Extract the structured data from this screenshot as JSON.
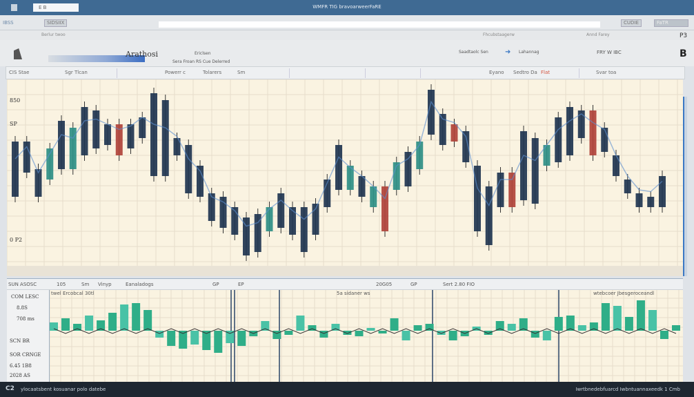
{
  "window": {
    "tab_label": "E B",
    "title": "WMFR TIG bravoarweerFaRE"
  },
  "address_bar": {
    "left_label": "IBSS",
    "left_button": "SIDSIIX",
    "right_button": "CUDIE",
    "far_right_button": "FaTR"
  },
  "menubar": {
    "item_left": "Berlur twoo",
    "item_mid": "Fhcubstaagerw",
    "item_right": "Annd Farey",
    "page_indicator": "P3"
  },
  "ribbon": {
    "title": "Arathosi",
    "sub1": "Ericlsen",
    "sub2": "Sera Froan RS Cue Delerred",
    "right1": "Saadtaolc Sen",
    "right2": "Lahannag",
    "right3": "FRY W IBC",
    "right_letter": "B"
  },
  "toolbar": {
    "items": [
      "CIS Stae",
      "Sgr Tlcan",
      "Powerr c",
      "Tolarers",
      "Sm",
      "Eyano",
      "Sedtro Da",
      "Flat",
      "Svar toa"
    ]
  },
  "main_chart": {
    "y_labels": [
      "850",
      "SP",
      "0 P2"
    ],
    "colors": {
      "bg": "#faf3e1",
      "candle_dark": "#1f3550",
      "candle_teal": "#2e8f86",
      "candle_red": "#b0433a",
      "line": "#5b8fd0"
    }
  },
  "chart_data": {
    "type": "candlestick",
    "ylim": [
      0,
      285
    ],
    "candles": [
      {
        "h": 195,
        "l": 115,
        "c": "dark"
      },
      {
        "h": 195,
        "l": 150,
        "c": "dark"
      },
      {
        "h": 155,
        "l": 115,
        "c": "dark"
      },
      {
        "h": 185,
        "l": 140,
        "c": "teal"
      },
      {
        "h": 225,
        "l": 155,
        "c": "dark"
      },
      {
        "h": 215,
        "l": 155,
        "c": "teal"
      },
      {
        "h": 245,
        "l": 175,
        "c": "dark"
      },
      {
        "h": 240,
        "l": 185,
        "c": "dark"
      },
      {
        "h": 220,
        "l": 190,
        "c": "dark"
      },
      {
        "h": 220,
        "l": 175,
        "c": "red"
      },
      {
        "h": 220,
        "l": 185,
        "c": "dark"
      },
      {
        "h": 230,
        "l": 200,
        "c": "dark"
      },
      {
        "h": 265,
        "l": 145,
        "c": "dark"
      },
      {
        "h": 255,
        "l": 145,
        "c": "dark"
      },
      {
        "h": 200,
        "l": 175,
        "c": "dark"
      },
      {
        "h": 190,
        "l": 120,
        "c": "dark"
      },
      {
        "h": 160,
        "l": 115,
        "c": "dark"
      },
      {
        "h": 120,
        "l": 80,
        "c": "dark"
      },
      {
        "h": 115,
        "l": 70,
        "c": "dark"
      },
      {
        "h": 100,
        "l": 60,
        "c": "dark"
      },
      {
        "h": 85,
        "l": 30,
        "c": "dark"
      },
      {
        "h": 90,
        "l": 35,
        "c": "dark"
      },
      {
        "h": 100,
        "l": 65,
        "c": "teal"
      },
      {
        "h": 120,
        "l": 70,
        "c": "dark"
      },
      {
        "h": 100,
        "l": 60,
        "c": "dark"
      },
      {
        "h": 100,
        "l": 35,
        "c": "dark"
      },
      {
        "h": 105,
        "l": 60,
        "c": "dark"
      },
      {
        "h": 140,
        "l": 100,
        "c": "dark"
      },
      {
        "h": 190,
        "l": 125,
        "c": "dark"
      },
      {
        "h": 160,
        "l": 125,
        "c": "teal"
      },
      {
        "h": 145,
        "l": 115,
        "c": "dark"
      },
      {
        "h": 130,
        "l": 100,
        "c": "teal"
      },
      {
        "h": 130,
        "l": 65,
        "c": "red"
      },
      {
        "h": 165,
        "l": 125,
        "c": "teal"
      },
      {
        "h": 180,
        "l": 130,
        "c": "dark"
      },
      {
        "h": 195,
        "l": 155,
        "c": "teal"
      },
      {
        "h": 270,
        "l": 205,
        "c": "dark"
      },
      {
        "h": 235,
        "l": 190,
        "c": "dark"
      },
      {
        "h": 220,
        "l": 195,
        "c": "red"
      },
      {
        "h": 210,
        "l": 165,
        "c": "dark"
      },
      {
        "h": 160,
        "l": 65,
        "c": "dark"
      },
      {
        "h": 130,
        "l": 45,
        "c": "dark"
      },
      {
        "h": 150,
        "l": 100,
        "c": "dark"
      },
      {
        "h": 150,
        "l": 100,
        "c": "red"
      },
      {
        "h": 210,
        "l": 110,
        "c": "dark"
      },
      {
        "h": 200,
        "l": 105,
        "c": "dark"
      },
      {
        "h": 190,
        "l": 160,
        "c": "teal"
      },
      {
        "h": 230,
        "l": 165,
        "c": "dark"
      },
      {
        "h": 245,
        "l": 175,
        "c": "dark"
      },
      {
        "h": 240,
        "l": 200,
        "c": "dark"
      },
      {
        "h": 240,
        "l": 175,
        "c": "red"
      },
      {
        "h": 215,
        "l": 180,
        "c": "dark"
      },
      {
        "h": 175,
        "l": 145,
        "c": "dark"
      },
      {
        "h": 140,
        "l": 120,
        "c": "dark"
      },
      {
        "h": 120,
        "l": 100,
        "c": "dark"
      },
      {
        "h": 115,
        "l": 100,
        "c": "dark"
      },
      {
        "h": 145,
        "l": 100,
        "c": "dark"
      }
    ],
    "volume": [
      12,
      18,
      10,
      22,
      15,
      26,
      38,
      40,
      30,
      -10,
      -22,
      -26,
      -20,
      -28,
      -32,
      -18,
      -22,
      -8,
      14,
      -12,
      -6,
      22,
      8,
      -10,
      10,
      -6,
      -8,
      4,
      -4,
      18,
      -14,
      8,
      10,
      -6,
      -14,
      -8,
      6,
      -6,
      14,
      10,
      18,
      -10,
      -14,
      20,
      22,
      8,
      12,
      40,
      36,
      20,
      44,
      30,
      -12,
      8
    ]
  },
  "lower_panel": {
    "header": [
      "SUN ASOSC",
      "105",
      "Sm",
      "Vinyp",
      "Eanaladogs",
      "GP",
      "EP",
      "20G05",
      "GP",
      "Sert 2.80 FIO"
    ],
    "sub_left": "twel Ercobcal 30tl",
    "sub_mid": "5a sidaner ws",
    "sub_right": "wtebcoer Jbesgeroceandl",
    "y_labels": [
      "COM LESC",
      "8.8S",
      "708 ms",
      "SCN BR",
      "SOR CRNGE",
      "6.45 1B8",
      "2028 AS"
    ]
  },
  "status": {
    "icon": "C2",
    "left_text": "ylocaatsbent kosuanar polo datebe",
    "right_text": "Iwrtbnedebfuarcd Iwbntuannaxeedk 1 Cmb"
  }
}
